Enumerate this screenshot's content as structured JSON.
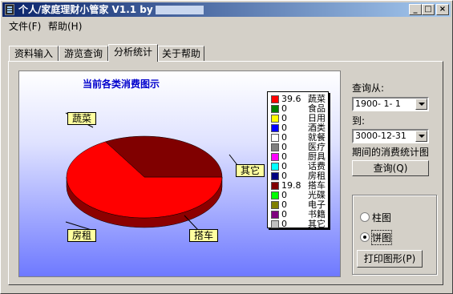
{
  "window": {
    "title": "个人/家庭理财小管家 V1.1 by",
    "controls": [
      "minimize",
      "maximize",
      "close"
    ]
  },
  "menu": [
    {
      "label": "文件(F)"
    },
    {
      "label": "帮助(H)"
    }
  ],
  "tabs": [
    {
      "label": "资料输入",
      "active": false
    },
    {
      "label": "游览查询",
      "active": false
    },
    {
      "label": "分析统计",
      "active": true
    },
    {
      "label": "关于帮助",
      "active": false
    }
  ],
  "query": {
    "from_label": "查询从:",
    "from_value": "1900- 1- 1",
    "to_label": "到:",
    "to_value": "3000-12-31",
    "period_label": "期间的消费统计图",
    "query_button": "查询(Q)"
  },
  "chart_options": {
    "bar_label": "柱图",
    "pie_label": "饼图",
    "selected": "pie",
    "print_button": "打印图形(P)"
  },
  "colors": {
    "title_blue": "#0000cc",
    "slice_vegetables": "#ff0000",
    "slice_taxi": "#800000"
  },
  "chart_data": {
    "type": "pie",
    "title": "当前各类消费图示",
    "legend_position": "right",
    "categories": [
      "蔬菜",
      "食品",
      "日用",
      "酒类",
      "就餐",
      "医疗",
      "厨具",
      "话费",
      "房租",
      "搭车",
      "光碟",
      "电子",
      "书籍",
      "其它"
    ],
    "values": [
      39.6,
      0,
      0,
      0,
      0,
      0,
      0,
      0,
      0,
      19.8,
      0,
      0,
      0,
      0
    ],
    "value_labels": [
      "39.6",
      "0",
      "0",
      "0",
      "0",
      "0",
      "0",
      "0",
      "0",
      "19.8",
      "0",
      "0",
      "0",
      "0"
    ],
    "legend_colors": [
      "#ff0000",
      "#008000",
      "#ffff00",
      "#0000ff",
      "#ffffff",
      "#808080",
      "#ff00ff",
      "#00ffff",
      "#000080",
      "#800000",
      "#00ff00",
      "#808000",
      "#800080",
      "#c0c0c0"
    ],
    "callouts": [
      "蔬菜",
      "其它",
      "房租",
      "搭车"
    ]
  }
}
